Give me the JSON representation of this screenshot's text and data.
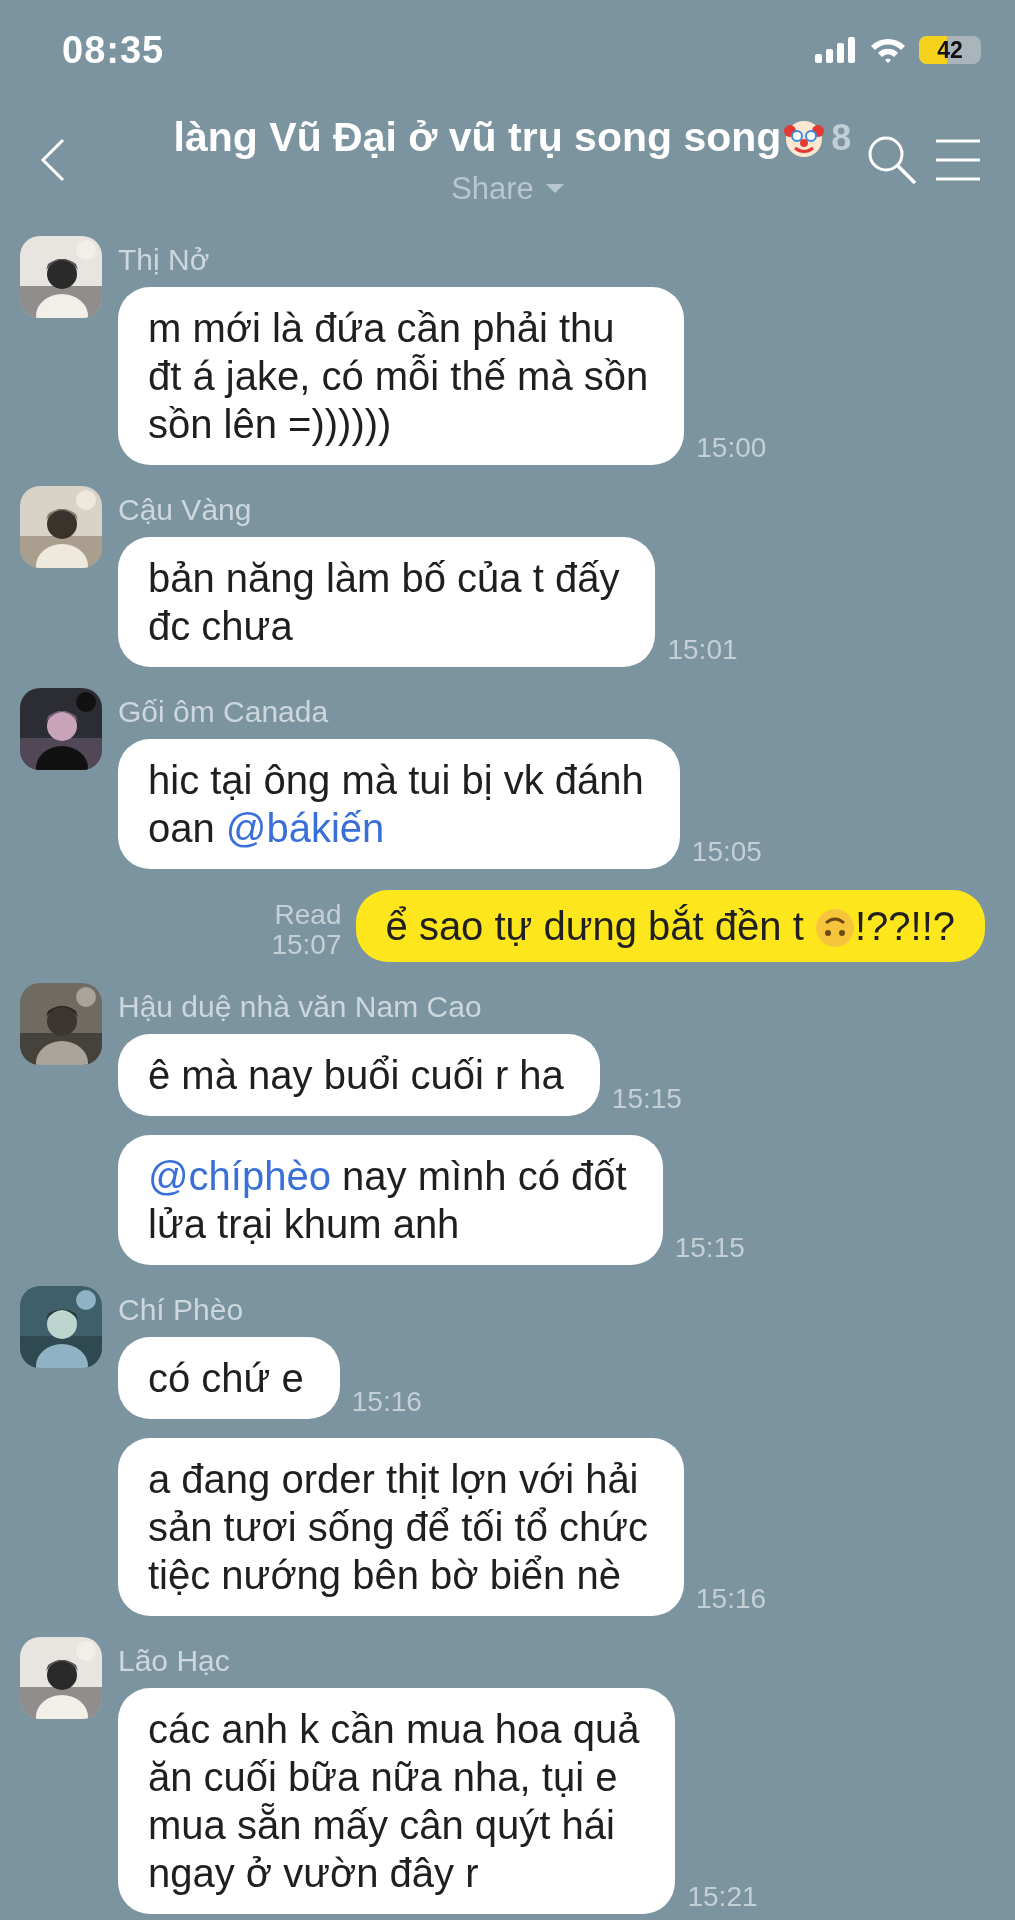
{
  "status_bar": {
    "time": "08:35",
    "battery": "42"
  },
  "header": {
    "title": "làng Vũ Đại ở vũ trụ song song",
    "member_count": "8",
    "subtitle": "Share"
  },
  "messages": [
    {
      "kind": "incoming",
      "sender": "Thị Nở",
      "bubbles": [
        {
          "time": "15:00",
          "parts": [
            {
              "kind": "text",
              "text": "m mới là đứa cần phải thu\nđt á jake, có mỗi thế mà sồn\nsồn lên =))))))"
            }
          ]
        }
      ]
    },
    {
      "kind": "incoming",
      "sender": "Cậu Vàng",
      "bubbles": [
        {
          "time": "15:01",
          "parts": [
            {
              "kind": "text",
              "text": "bản năng làm bố của t đấy\nđc chưa"
            }
          ]
        }
      ]
    },
    {
      "kind": "incoming",
      "sender": "Gối ôm Canada",
      "bubbles": [
        {
          "time": "15:05",
          "parts": [
            {
              "kind": "text",
              "text": "hic tại ông mà tui bị vk đánh\noan "
            },
            {
              "kind": "mention",
              "text": "@bákiến"
            }
          ]
        }
      ]
    },
    {
      "kind": "outgoing",
      "read": "Read",
      "time": "15:07",
      "parts": [
        {
          "kind": "text",
          "text": "ể sao tự dưng bắt đền t "
        },
        {
          "kind": "emoji"
        },
        {
          "kind": "text",
          "text": "!??!!?"
        }
      ]
    },
    {
      "kind": "incoming",
      "sender": "Hậu duệ nhà văn Nam Cao",
      "bubbles": [
        {
          "time": "15:15",
          "parts": [
            {
              "kind": "text",
              "text": "ê mà nay buổi cuối r ha"
            }
          ]
        },
        {
          "time": "15:15",
          "parts": [
            {
              "kind": "mention",
              "text": "@chíphèo"
            },
            {
              "kind": "text",
              "text": " nay mình có đốt\nlửa trại khum anh"
            }
          ]
        }
      ]
    },
    {
      "kind": "incoming",
      "sender": "Chí Phèo",
      "bubbles": [
        {
          "time": "15:16",
          "parts": [
            {
              "kind": "text",
              "text": "có chứ e"
            }
          ]
        },
        {
          "time": "15:16",
          "parts": [
            {
              "kind": "text",
              "text": "a đang order thịt lợn với hải\nsản tươi sống để tối tổ chức\ntiệc nướng bên bờ biển nè"
            }
          ]
        }
      ]
    },
    {
      "kind": "incoming",
      "sender": "Lão Hạc",
      "bubbles": [
        {
          "time": "15:21",
          "parts": [
            {
              "kind": "text",
              "text": "các anh k cần mua hoa quả\năn cuối bữa nữa nha, tụi e\nmua sẵn mấy cân quýt hái\nngay ở vườn đây r"
            }
          ]
        }
      ]
    }
  ]
}
